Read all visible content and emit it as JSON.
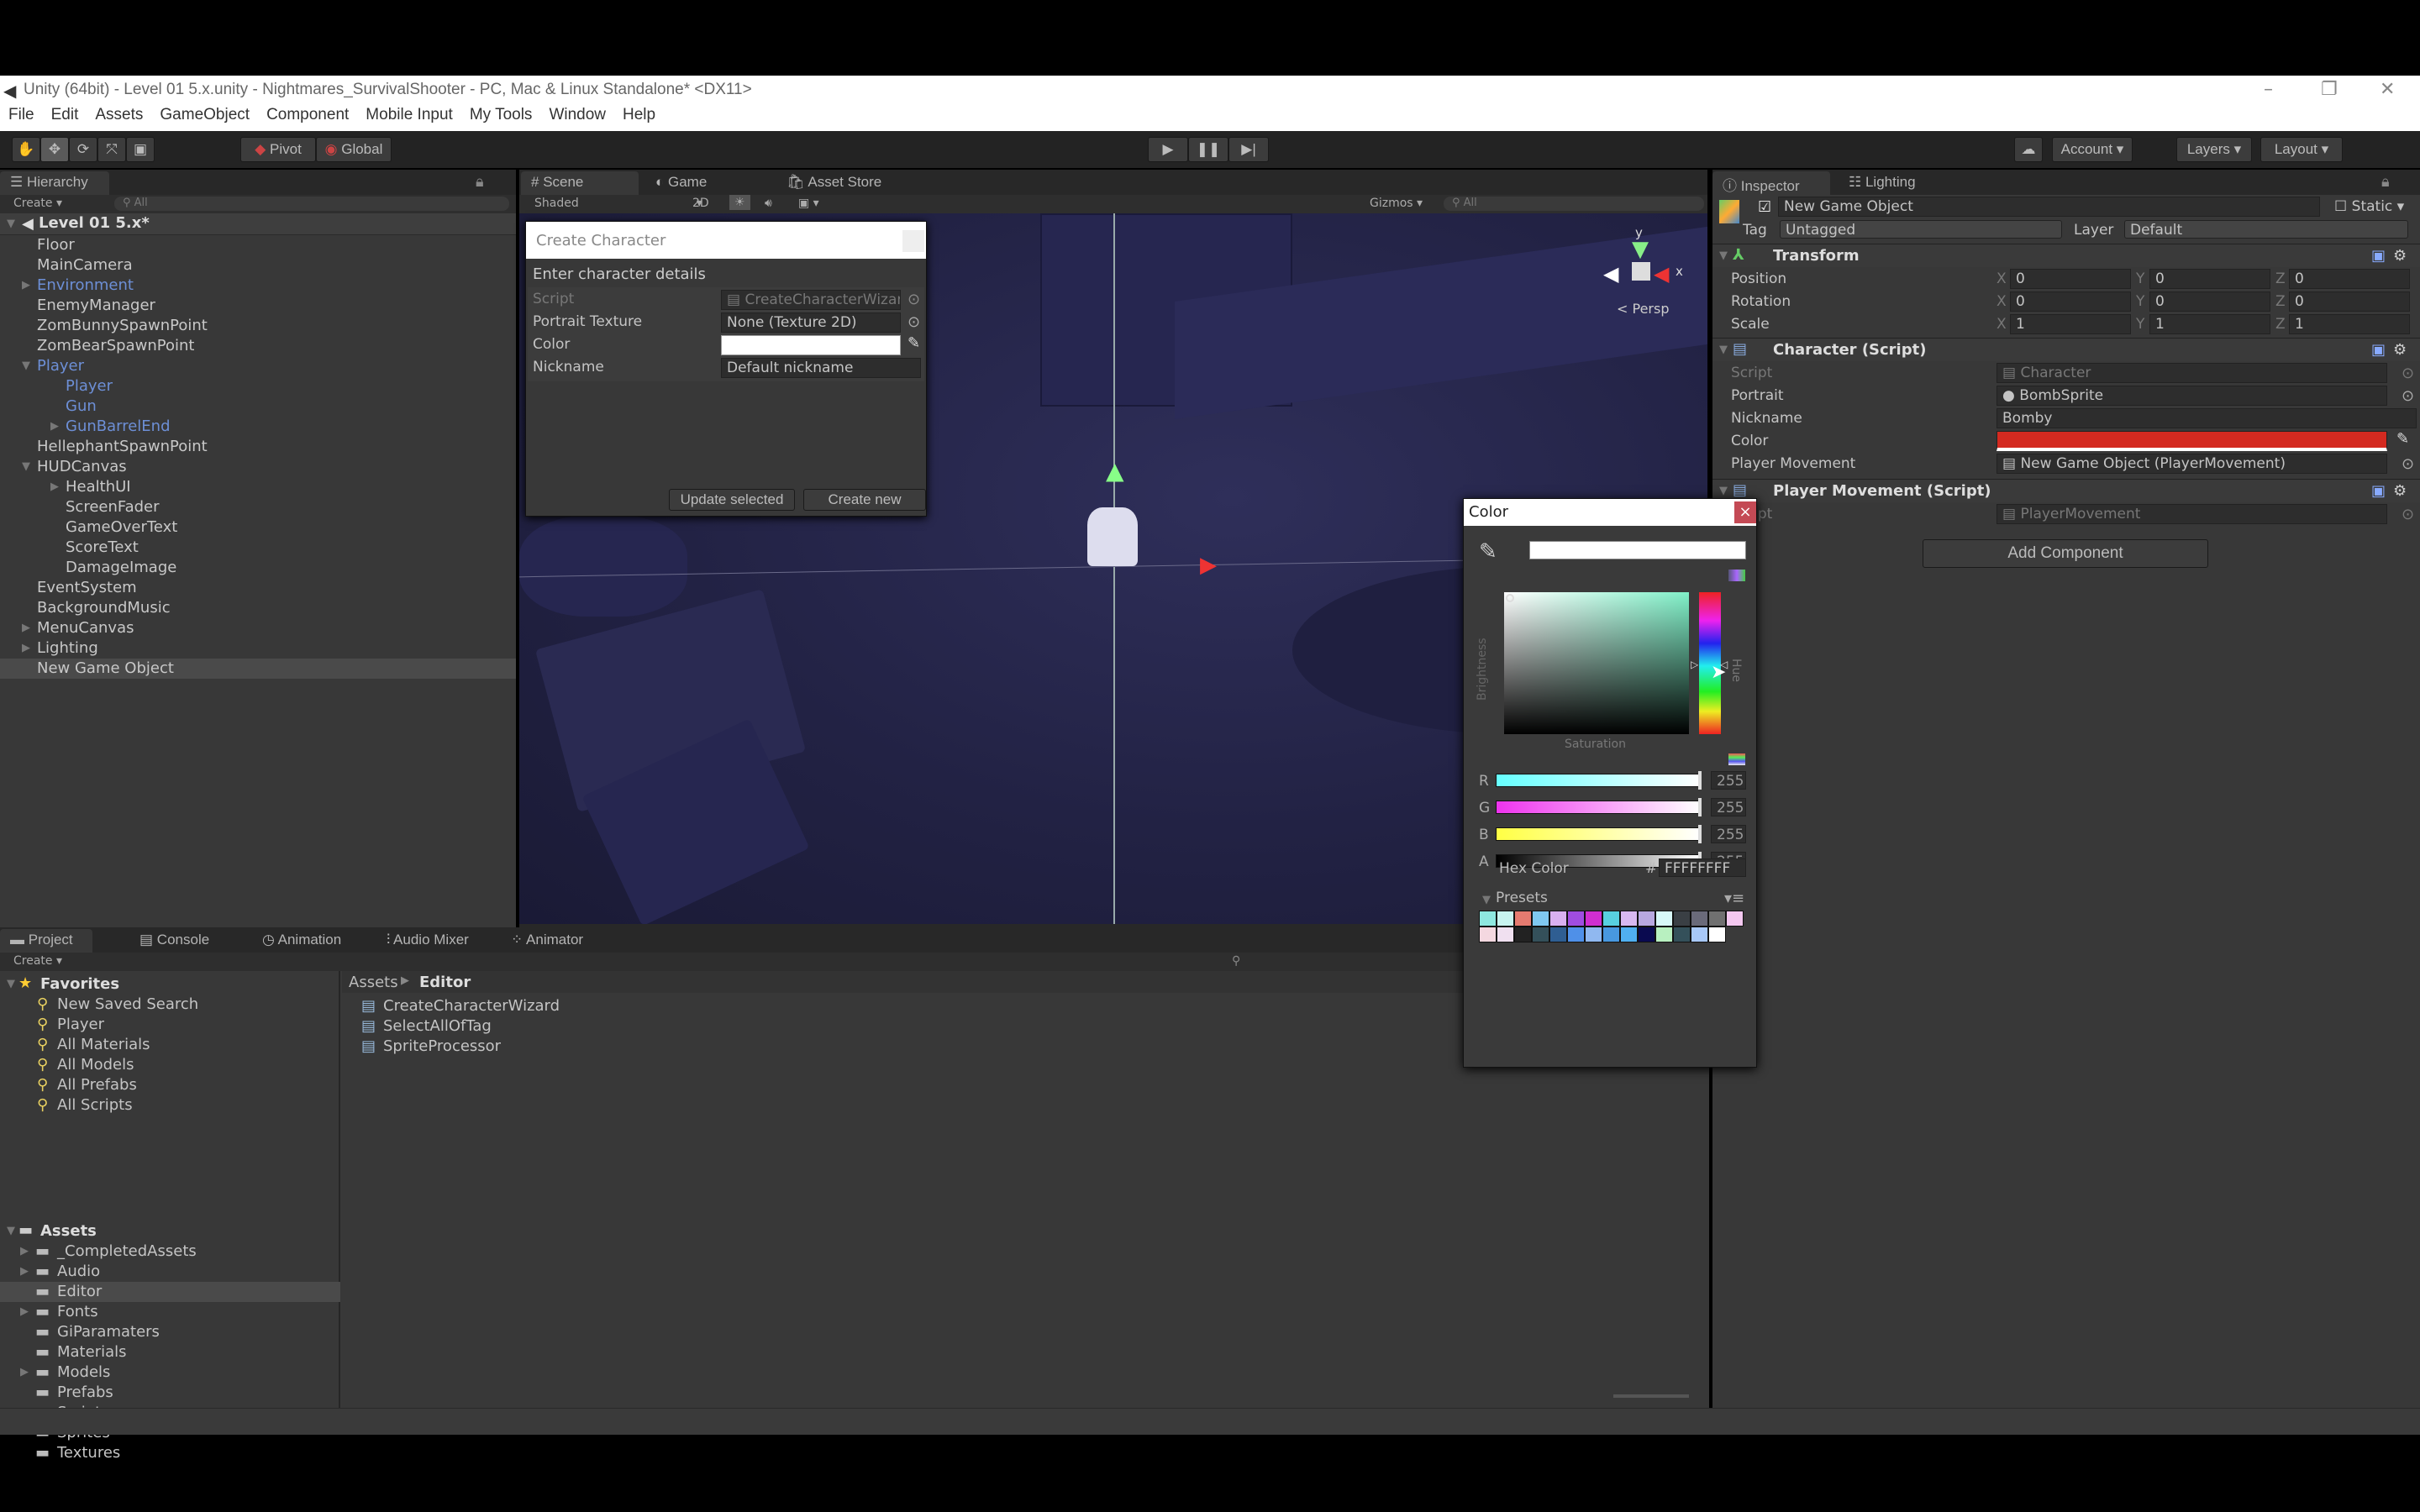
{
  "window": {
    "title": "Unity (64bit) - Level 01 5.x.unity - Nightmares_SurvivalShooter - PC, Mac & Linux Standalone* <DX11>"
  },
  "menu": [
    "File",
    "Edit",
    "Assets",
    "GameObject",
    "Component",
    "Mobile Input",
    "My Tools",
    "Window",
    "Help"
  ],
  "toolbar": {
    "pivot": "Pivot",
    "global": "Global",
    "account": "Account",
    "layers": "Layers",
    "layout": "Layout"
  },
  "hierarchy": {
    "tab": "Hierarchy",
    "create": "Create",
    "search_placeholder": "All",
    "scene": "Level 01 5.x*",
    "items": [
      {
        "label": "Floor",
        "indent": 1,
        "prefab": false,
        "arrow": ""
      },
      {
        "label": "MainCamera",
        "indent": 1,
        "prefab": false,
        "arrow": ""
      },
      {
        "label": "Environment",
        "indent": 1,
        "prefab": true,
        "arrow": "▶"
      },
      {
        "label": "EnemyManager",
        "indent": 1,
        "prefab": false,
        "arrow": ""
      },
      {
        "label": "ZomBunnySpawnPoint",
        "indent": 1,
        "prefab": false,
        "arrow": ""
      },
      {
        "label": "ZomBearSpawnPoint",
        "indent": 1,
        "prefab": false,
        "arrow": ""
      },
      {
        "label": "Player",
        "indent": 1,
        "prefab": true,
        "arrow": "▼"
      },
      {
        "label": "Player",
        "indent": 2,
        "prefab": true,
        "arrow": ""
      },
      {
        "label": "Gun",
        "indent": 2,
        "prefab": true,
        "arrow": ""
      },
      {
        "label": "GunBarrelEnd",
        "indent": 2,
        "prefab": true,
        "arrow": "▶"
      },
      {
        "label": "HellephantSpawnPoint",
        "indent": 1,
        "prefab": false,
        "arrow": ""
      },
      {
        "label": "HUDCanvas",
        "indent": 1,
        "prefab": false,
        "arrow": "▼"
      },
      {
        "label": "HealthUI",
        "indent": 2,
        "prefab": false,
        "arrow": "▶"
      },
      {
        "label": "ScreenFader",
        "indent": 2,
        "prefab": false,
        "arrow": ""
      },
      {
        "label": "GameOverText",
        "indent": 2,
        "prefab": false,
        "arrow": ""
      },
      {
        "label": "ScoreText",
        "indent": 2,
        "prefab": false,
        "arrow": ""
      },
      {
        "label": "DamageImage",
        "indent": 2,
        "prefab": false,
        "arrow": ""
      },
      {
        "label": "EventSystem",
        "indent": 1,
        "prefab": false,
        "arrow": ""
      },
      {
        "label": "BackgroundMusic",
        "indent": 1,
        "prefab": false,
        "arrow": ""
      },
      {
        "label": "MenuCanvas",
        "indent": 1,
        "prefab": false,
        "arrow": "▶"
      },
      {
        "label": "Lighting",
        "indent": 1,
        "prefab": false,
        "arrow": "▶"
      },
      {
        "label": "New Game Object",
        "indent": 1,
        "prefab": false,
        "arrow": "",
        "selected": true
      }
    ]
  },
  "scene": {
    "tabs": [
      "Scene",
      "Game",
      "Asset Store"
    ],
    "shading": "Shaded",
    "mode_2d": "2D",
    "gizmos": "Gizmos",
    "search_placeholder": "All",
    "persp": "Persp",
    "axis_y": "y",
    "axis_x": "x"
  },
  "wizard": {
    "title": "Create Character",
    "heading": "Enter character details",
    "fields": [
      {
        "label": "Script",
        "value": "CreateCharacterWizard"
      },
      {
        "label": "Portrait Texture",
        "value": "None (Texture 2D)"
      },
      {
        "label": "Color",
        "value": "#FFFFFF"
      },
      {
        "label": "Nickname",
        "value": "Default nickname"
      }
    ],
    "update_button": "Update selected",
    "create_button": "Create new"
  },
  "color_picker": {
    "title": "Color",
    "close": "×",
    "brightness": "Brightness",
    "saturation": "Saturation",
    "hue": "Hue",
    "channels": [
      {
        "label": "R",
        "value": "255"
      },
      {
        "label": "G",
        "value": "255"
      },
      {
        "label": "B",
        "value": "255"
      },
      {
        "label": "A",
        "value": "255"
      }
    ],
    "hex_label": "Hex Color",
    "hash": "#",
    "hex": "FFFFFFFF",
    "presets_label": "Presets",
    "presets": [
      "#8ee8e0",
      "#c8f4f0",
      "#e57b70",
      "#7fc8f0",
      "#d9b0f0",
      "#a04de0",
      "#d02ed0",
      "#58d0e0",
      "#d8b8f0",
      "#b8a8e0",
      "#d8f8f8",
      "#3a3f44",
      "#6a6a7a",
      "#707070",
      "#f4c8f0",
      "#f4d8e0",
      "#f0e0f0",
      "#222222",
      "#34505a",
      "#2f5e92",
      "#4f90e8",
      "#90b8f0",
      "#4898e0",
      "#50b0f0",
      "#0a0a50",
      "#b8f0c0",
      "#34505a",
      "#a8c8f8",
      "#ffffff"
    ]
  },
  "inspector": {
    "tabs": [
      "Inspector",
      "Lighting"
    ],
    "object_name": "New Game Object",
    "static": "Static",
    "tag_label": "Tag",
    "tag": "Untagged",
    "layer_label": "Layer",
    "layer": "Default",
    "transform": {
      "title": "Transform",
      "rows": [
        {
          "label": "Position",
          "x": "0",
          "y": "0",
          "z": "0"
        },
        {
          "label": "Rotation",
          "x": "0",
          "y": "0",
          "z": "0"
        },
        {
          "label": "Scale",
          "x": "1",
          "y": "1",
          "z": "1"
        }
      ]
    },
    "character": {
      "title": "Character (Script)",
      "script_label": "Script",
      "script": "Character",
      "portrait_label": "Portrait",
      "portrait": "BombSprite",
      "nickname_label": "Nickname",
      "nickname": "Bomby",
      "color_label": "Color",
      "color": "#d42a20",
      "movement_label": "Player Movement",
      "movement": "New Game Object (PlayerMovement)"
    },
    "player_movement": {
      "title": "Player Movement (Script)",
      "script_label": "Script",
      "script": "PlayerMovement"
    },
    "add_component": "Add Component"
  },
  "bottom": {
    "tabs": [
      "Project",
      "Console",
      "Animation",
      "Audio Mixer",
      "Animator"
    ],
    "create": "Create",
    "favorites_label": "Favorites",
    "favorites": [
      "New Saved Search",
      "Player",
      "All Materials",
      "All Models",
      "All Prefabs",
      "All Scripts"
    ],
    "assets_label": "Assets",
    "folders": [
      {
        "label": "_CompletedAssets",
        "arrow": "▶"
      },
      {
        "label": "Audio",
        "arrow": "▶"
      },
      {
        "label": "Editor",
        "arrow": "",
        "selected": true
      },
      {
        "label": "Fonts",
        "arrow": "▶"
      },
      {
        "label": "GiParamaters",
        "arrow": ""
      },
      {
        "label": "Materials",
        "arrow": ""
      },
      {
        "label": "Models",
        "arrow": "▶"
      },
      {
        "label": "Prefabs",
        "arrow": ""
      },
      {
        "label": "Scripts",
        "arrow": "▶"
      },
      {
        "label": "Sprites",
        "arrow": ""
      },
      {
        "label": "Textures",
        "arrow": ""
      }
    ],
    "breadcrumb": [
      "Assets",
      "Editor"
    ],
    "files": [
      "CreateCharacterWizard",
      "SelectAllOfTag",
      "SpriteProcessor"
    ]
  }
}
